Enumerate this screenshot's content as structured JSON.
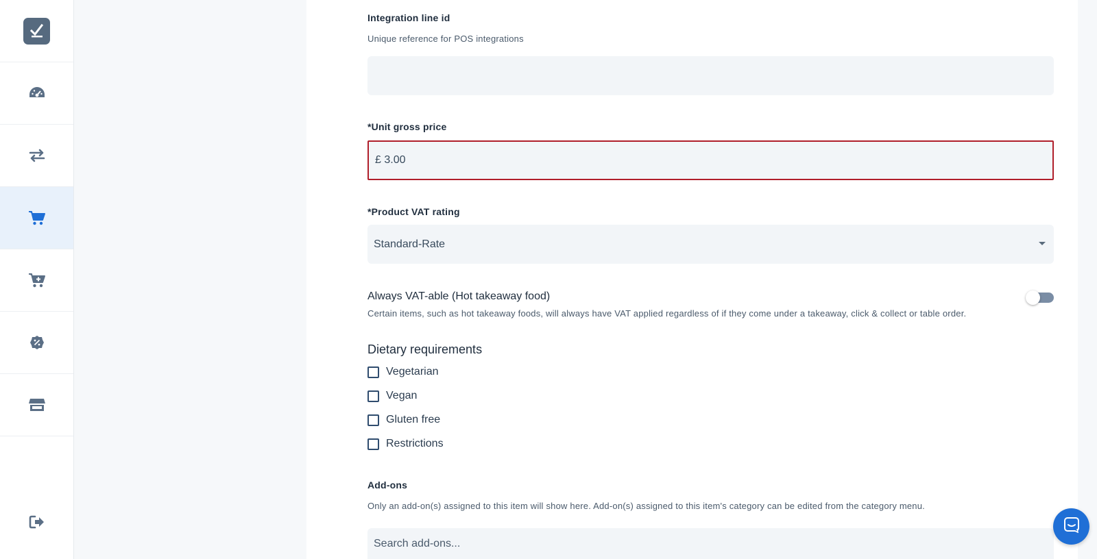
{
  "sidebar": {
    "items": [
      {
        "icon": "logo-check-icon"
      },
      {
        "icon": "dashboard-gauge-icon"
      },
      {
        "icon": "transfer-arrows-icon"
      },
      {
        "icon": "shopping-cart-icon",
        "active": true
      },
      {
        "icon": "cart-plus-icon"
      },
      {
        "icon": "discount-badge-icon"
      },
      {
        "icon": "store-icon"
      },
      {
        "icon": "logout-icon"
      }
    ]
  },
  "form": {
    "integration": {
      "label": "Integration line id",
      "help": "Unique reference for POS integrations",
      "value": ""
    },
    "price": {
      "label": "*Unit gross price",
      "value": "£ 3.00"
    },
    "vat": {
      "label": "*Product VAT rating",
      "selected": "Standard-Rate"
    },
    "always_vat": {
      "label": "Always VAT-able (Hot takeaway food)",
      "help": "Certain items, such as hot takeaway foods, will always have VAT applied regardless of if they come under a takeaway, click & collect or table order.",
      "enabled": false
    },
    "dietary": {
      "title": "Dietary requirements",
      "options": [
        "Vegetarian",
        "Vegan",
        "Gluten free",
        "Restrictions"
      ]
    },
    "addons": {
      "label": "Add-ons",
      "help": "Only an add-on(s) assigned to this item will show here. Add-on(s) assigned to this item's category can be edited from the category menu.",
      "search_placeholder": "Search add-ons..."
    }
  },
  "colors": {
    "accent": "#1f6fd6",
    "error_border": "#b01e2a",
    "sidebar_active_bg": "#e8f1fb"
  }
}
